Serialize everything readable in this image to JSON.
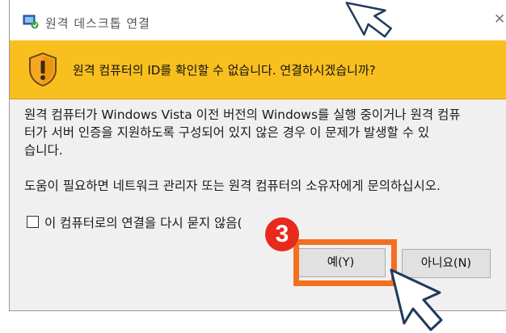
{
  "window": {
    "title": "원격 데스크톱 연결",
    "close_glyph": "✕"
  },
  "banner": {
    "message": "원격 컴퓨터의 ID를 확인할 수 없습니다. 연결하시겠습니까?",
    "color": "#f8bf1f"
  },
  "body": {
    "line1": "원격 컴퓨터가 Windows Vista 이전 버전의 Windows를 실행 중이거나 원격 컴퓨",
    "line2": "터가 서버 인증을 지원하도록 구성되어 있지 않은 경우 이 문제가 발생할 수 있",
    "line3": "습니다.",
    "line4": "도움이 필요하면 네트워크 관리자 또는 원격 컴퓨터의 소유자에게 문의하십시오."
  },
  "checkbox": {
    "label": "이 컴퓨터로의 연결을 다시 묻지 않음(",
    "checked": false
  },
  "buttons": {
    "yes_label": "예(Y)",
    "no_label": "아니요(N)"
  },
  "annotation": {
    "step_number": "3",
    "highlight_color": "#f36f21",
    "badge_color": "#e8291c"
  },
  "icons": {
    "app": "remote-desktop-icon",
    "warning": "warning-shield-icon",
    "close": "close-icon",
    "pointer": "pointer-cursor-icon"
  }
}
